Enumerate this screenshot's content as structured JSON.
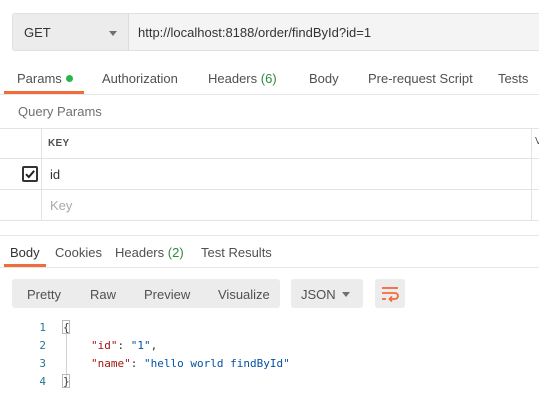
{
  "request": {
    "method": "GET",
    "url": "http://localhost:8188/order/findById?id=1"
  },
  "request_tabs": {
    "params": "Params",
    "authorization": "Authorization",
    "headers": "Headers",
    "headers_count": "(6)",
    "body": "Body",
    "prerequest": "Pre-request Script",
    "tests": "Tests"
  },
  "query_params": {
    "title": "Query Params",
    "key_header": "KEY",
    "value_header_partial": "V",
    "rows": [
      {
        "checked": true,
        "key": "id"
      }
    ],
    "placeholder": "Key"
  },
  "response_tabs": {
    "body": "Body",
    "cookies": "Cookies",
    "headers": "Headers",
    "headers_count": "(2)",
    "test_results": "Test Results"
  },
  "view_modes": {
    "pretty": "Pretty",
    "raw": "Raw",
    "preview": "Preview",
    "visualize": "Visualize"
  },
  "format": "JSON",
  "code": {
    "line_numbers": [
      "1",
      "2",
      "3",
      "4"
    ],
    "open_brace": "{",
    "close_brace": "}",
    "id_key": "\"id\"",
    "id_value": "\"1\"",
    "name_key": "\"name\"",
    "name_value": "\"hello world findById\"",
    "colon": ": ",
    "comma": ","
  },
  "colors": {
    "accent": "#f26b3a",
    "status_green": "#26b64c",
    "count_green": "#2b8a3e"
  },
  "icons": [
    "chevron-down-icon",
    "checkmark-icon",
    "wrap-lines-icon"
  ]
}
